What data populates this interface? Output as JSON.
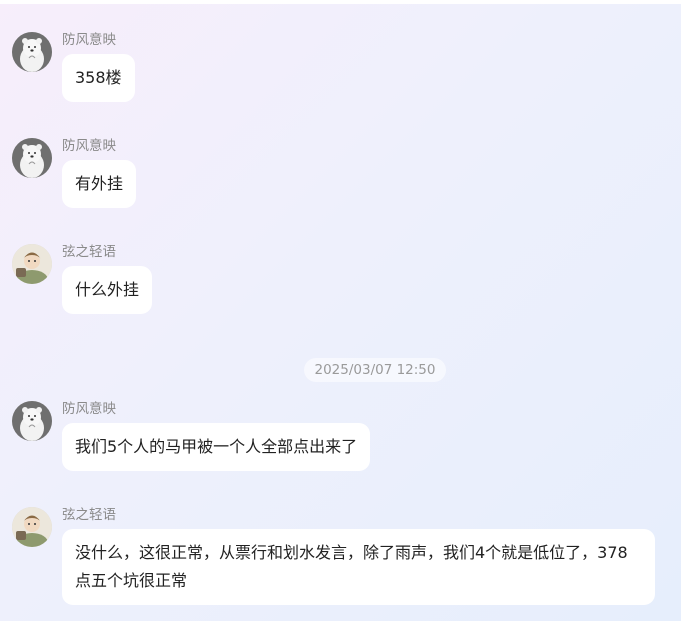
{
  "messages": [
    {
      "sender": "防风意映",
      "avatar": "white-bear-avatar",
      "text": "358楼"
    },
    {
      "sender": "防风意映",
      "avatar": "white-bear-avatar",
      "text": "有外挂"
    },
    {
      "sender": "弦之轻语",
      "avatar": "character-avatar",
      "text": "什么外挂"
    },
    {
      "sender": "防风意映",
      "avatar": "white-bear-avatar",
      "text": "我们5个人的马甲被一个人全部点出来了"
    },
    {
      "sender": "弦之轻语",
      "avatar": "character-avatar",
      "text": "没什么，这很正常，从票行和划水发言，除了雨声，我们4个就是低位了，378点五个坑很正常"
    }
  ],
  "timestamp": "2025/03/07 12:50",
  "colors": {
    "background_start": "#f7eefb",
    "background_end": "#e6eefc",
    "bubble": "#ffffff",
    "sender_text": "#8a8a8a",
    "message_text": "#222222"
  }
}
